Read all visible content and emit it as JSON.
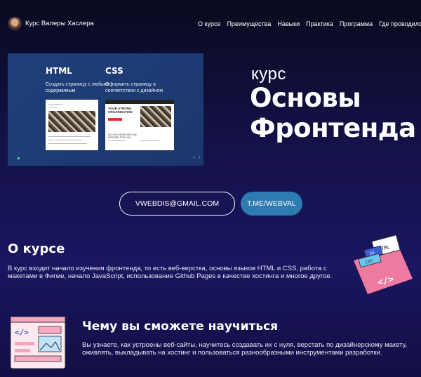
{
  "header": {
    "brand": "Курс Валеры Хаслера",
    "nav": [
      "О курсе",
      "Преимущества",
      "Навыки",
      "Практика",
      "Программа",
      "Где проводился"
    ]
  },
  "slider": {
    "html": {
      "title": "HTML",
      "sub": "Создать страницу с любым содержимым"
    },
    "css": {
      "title": "CSS",
      "sub": "Оформить страницу в соответствии с дизайном"
    },
    "mock_headline": "YOUR STRONG ORGANISATION",
    "mock_sub": "DO YOU KNOW WE CAN PROVIDE FOR YOU",
    "prev": "‹",
    "next": "›"
  },
  "hero": {
    "label": "курс",
    "title_line1": "Основы",
    "title_line2": "Фронтенда"
  },
  "contacts": {
    "email": "VWEBDIS@GMAIL.COM",
    "telegram": "T.ME/WEBVAL"
  },
  "about": {
    "title": "О курсе",
    "text": "В курс входит начало изучения фронтенда, то есть веб-верстка, основы языков HTML и CSS, работа с макетами в Фигме, начало JavaScript, использование Github Pages в качестве хостинга и многое другое."
  },
  "learn": {
    "title": "Чему вы сможете научиться",
    "text": "Вы узнаете, как устроены веб-сайты, научитесь создавать их с нуля, верстать по дизайнерскому макету, оживлять, выкладывать на хостинг и пользоваться разнообразными инструментами разработки."
  },
  "illustration": {
    "labels": [
      "HTML",
      "JS",
      "CSS"
    ],
    "code_glyph": "</>"
  }
}
